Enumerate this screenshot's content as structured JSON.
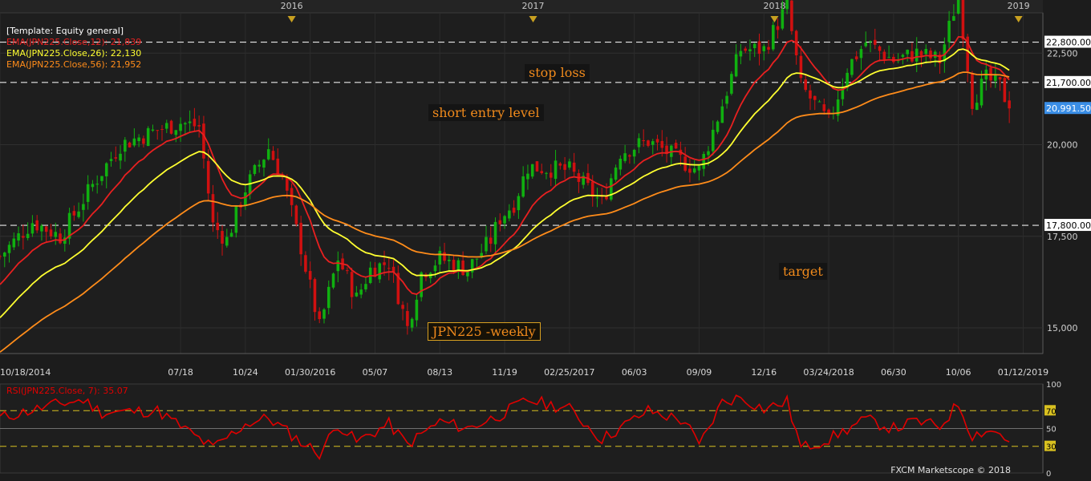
{
  "template_label": "[Template: Equity general]",
  "legend": [
    {
      "text": "EMA(JPN225.Close,12): 21,839",
      "color": "#e82020"
    },
    {
      "text": "EMA(JPN225.Close,26): 22,130",
      "color": "#ffff30"
    },
    {
      "text": "EMA(JPN225.Close,56): 21,952",
      "color": "#ff8c1a"
    }
  ],
  "annotations": {
    "stop_loss": "stop loss",
    "short_entry": "short entry level",
    "target": "target",
    "instrument": "JPN225 -weekly"
  },
  "rsi_title": "RSI(JPN225.Close, 7): 35.07",
  "credit": "FXCM Marketscope © 2018",
  "colors": {
    "up_candle": "#10b010",
    "down_candle": "#d01010",
    "ema12": "#e82020",
    "ema26": "#ffff30",
    "ema56": "#ff8c1a",
    "rsi_line": "#e00000",
    "last_price_bg": "#3a8ee6"
  },
  "chart_data": [
    {
      "type": "candlestick",
      "title": "JPN225 -weekly",
      "period": "weekly",
      "ylim": [
        14300,
        23600
      ],
      "y_ticks": [
        15000,
        17500,
        20000,
        22500
      ],
      "y_tick_labels": [
        "15,000",
        "17,500",
        "20,000",
        "22,500"
      ],
      "x_range": [
        "2014-10-18",
        "2019-01-26"
      ],
      "x_ticks": [
        "2014-10-18",
        "2015-07-18",
        "2015-10-24",
        "2016-01-30",
        "2016-05-07",
        "2016-08-13",
        "2016-11-19",
        "2017-02-25",
        "2017-06-03",
        "2017-09-09",
        "2017-12-16",
        "2018-03-24",
        "2018-06-30",
        "2018-10-06",
        "2019-01-12"
      ],
      "x_tick_labels": [
        "10/18/2014",
        "07/18",
        "10/24",
        "01/30/2016",
        "05/07",
        "08/13",
        "11/19",
        "02/25/2017",
        "06/03",
        "09/09",
        "12/16",
        "03/24/2018",
        "06/30",
        "10/06",
        "01/12/2019"
      ],
      "year_markers": [
        "2016",
        "2017",
        "2018",
        "2019"
      ],
      "year_marker_dates": [
        "2016-01-02",
        "2017-01-01",
        "2018-01-01",
        "2019-01-05"
      ],
      "horizontal_levels": [
        {
          "value": 22800,
          "label": "22,800.00",
          "name": "stop loss"
        },
        {
          "value": 21700,
          "label": "21,700.00",
          "name": "short entry level"
        },
        {
          "value": 17800,
          "label": "17,800.00",
          "name": "target"
        }
      ],
      "last_price": {
        "value": 20991.5,
        "label": "20,991.50"
      },
      "close_path": [
        [
          "2014-10-18",
          16950
        ],
        [
          "2014-12-06",
          17900
        ],
        [
          "2015-01-17",
          17500
        ],
        [
          "2015-03-07",
          18900
        ],
        [
          "2015-04-18",
          20000
        ],
        [
          "2015-06-13",
          20400
        ],
        [
          "2015-07-18",
          20600
        ],
        [
          "2015-08-15",
          20500
        ],
        [
          "2015-09-05",
          17800
        ],
        [
          "2015-09-26",
          17400
        ],
        [
          "2015-10-24",
          18800
        ],
        [
          "2015-11-28",
          19900
        ],
        [
          "2015-12-19",
          19100
        ],
        [
          "2016-01-16",
          17200
        ],
        [
          "2016-02-13",
          15000
        ],
        [
          "2016-03-12",
          16900
        ],
        [
          "2016-04-09",
          15800
        ],
        [
          "2016-04-30",
          16600
        ],
        [
          "2016-05-28",
          16800
        ],
        [
          "2016-06-25",
          15000
        ],
        [
          "2016-07-16",
          16500
        ],
        [
          "2016-08-13",
          16900
        ],
        [
          "2016-09-24",
          16600
        ],
        [
          "2016-10-29",
          17400
        ],
        [
          "2016-11-12",
          18000
        ],
        [
          "2016-12-03",
          18400
        ],
        [
          "2016-12-24",
          19400
        ],
        [
          "2017-02-25",
          19300
        ],
        [
          "2017-04-15",
          18400
        ],
        [
          "2017-05-13",
          19800
        ],
        [
          "2017-06-24",
          20100
        ],
        [
          "2017-08-19",
          19500
        ],
        [
          "2017-09-09",
          19300
        ],
        [
          "2017-10-14",
          21100
        ],
        [
          "2017-11-11",
          22600
        ],
        [
          "2017-12-16",
          22600
        ],
        [
          "2018-01-20",
          23800
        ],
        [
          "2018-02-10",
          21600
        ],
        [
          "2018-03-24",
          20600
        ],
        [
          "2018-04-21",
          22100
        ],
        [
          "2018-05-19",
          22800
        ],
        [
          "2018-06-30",
          22300
        ],
        [
          "2018-08-04",
          22500
        ],
        [
          "2018-09-08",
          22300
        ],
        [
          "2018-10-06",
          24100
        ],
        [
          "2018-10-27",
          21200
        ],
        [
          "2018-11-17",
          21800
        ],
        [
          "2018-12-08",
          21600
        ],
        [
          "2018-12-22",
          20992
        ]
      ],
      "series": [
        {
          "name": "EMA(JPN225.Close,12)",
          "period": 12
        },
        {
          "name": "EMA(JPN225.Close,26)",
          "period": 26
        },
        {
          "name": "EMA(JPN225.Close,56)",
          "period": 56
        }
      ]
    },
    {
      "type": "line",
      "title": "RSI(JPN225.Close, 7): 35.07",
      "ylim": [
        0,
        100
      ],
      "y_ticks": [
        0,
        30,
        50,
        70,
        100
      ],
      "y_tick_labels": [
        "0",
        "30",
        "50",
        "70",
        "100"
      ],
      "reference_levels": [
        30,
        50,
        70
      ],
      "series": [
        {
          "name": "RSI(JPN225.Close, 7)",
          "values_path": [
            [
              "2014-10-18",
              62
            ],
            [
              "2015-01-17",
              78
            ],
            [
              "2015-02-21",
              82
            ],
            [
              "2015-03-21",
              68
            ],
            [
              "2015-06-13",
              70
            ],
            [
              "2015-09-05",
              28
            ],
            [
              "2015-10-24",
              55
            ],
            [
              "2015-11-28",
              62
            ],
            [
              "2016-01-16",
              35
            ],
            [
              "2016-02-13",
              22
            ],
            [
              "2016-03-12",
              55
            ],
            [
              "2016-04-09",
              35
            ],
            [
              "2016-05-28",
              55
            ],
            [
              "2016-06-25",
              32
            ],
            [
              "2016-08-13",
              58
            ],
            [
              "2016-09-24",
              50
            ],
            [
              "2016-11-12",
              65
            ],
            [
              "2016-12-24",
              82
            ],
            [
              "2017-02-25",
              72
            ],
            [
              "2017-04-15",
              38
            ],
            [
              "2017-06-24",
              70
            ],
            [
              "2017-08-19",
              58
            ],
            [
              "2017-09-09",
              30
            ],
            [
              "2017-10-14",
              80
            ],
            [
              "2017-11-11",
              85
            ],
            [
              "2017-12-16",
              72
            ],
            [
              "2018-01-20",
              80
            ],
            [
              "2018-02-10",
              28
            ],
            [
              "2018-03-24",
              38
            ],
            [
              "2018-05-19",
              60
            ],
            [
              "2018-06-30",
              50
            ],
            [
              "2018-08-04",
              58
            ],
            [
              "2018-09-08",
              52
            ],
            [
              "2018-10-06",
              78
            ],
            [
              "2018-10-27",
              42
            ],
            [
              "2018-11-17",
              48
            ],
            [
              "2018-12-08",
              45
            ],
            [
              "2018-12-22",
              35.07
            ]
          ]
        }
      ]
    }
  ]
}
